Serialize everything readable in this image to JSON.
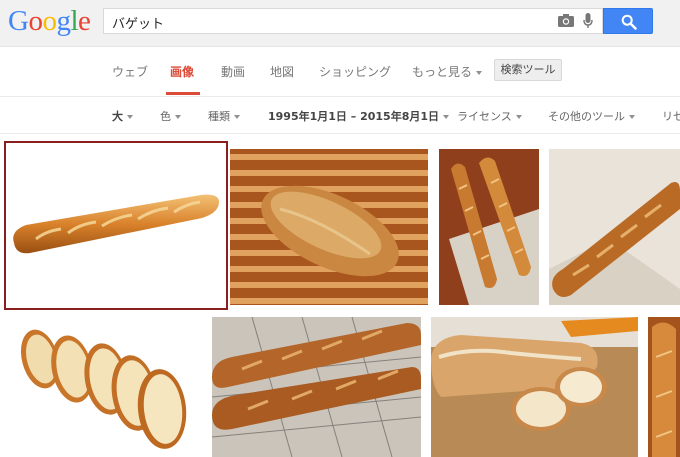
{
  "logo": {
    "letters": [
      "G",
      "o",
      "o",
      "g",
      "l",
      "e"
    ]
  },
  "search": {
    "query": "バゲット"
  },
  "tabs": [
    {
      "label": "ウェブ"
    },
    {
      "label": "画像"
    },
    {
      "label": "動画"
    },
    {
      "label": "地図"
    },
    {
      "label": "ショッピング"
    },
    {
      "label": "もっと見る"
    }
  ],
  "search_tools_label": "検索ツール",
  "filters": [
    {
      "label": "大"
    },
    {
      "label": "色"
    },
    {
      "label": "種類"
    },
    {
      "label": "1995年1月1日 – 2015年8月1日"
    },
    {
      "label": "ライセンス"
    },
    {
      "label": "その他のツール"
    },
    {
      "label": "リセ"
    }
  ],
  "colors": {
    "accent": "#dd4b39",
    "search_button": "#4285f4",
    "selection_border": "#8a1f1f"
  },
  "images": [
    {
      "name": "baguette-white-background"
    },
    {
      "name": "bread-on-rattan-mat"
    },
    {
      "name": "two-baguettes-on-board"
    },
    {
      "name": "baguette-on-cloth"
    },
    {
      "name": "sliced-baguette"
    },
    {
      "name": "baguettes-on-wire-rack"
    },
    {
      "name": "cut-baguette-on-board"
    },
    {
      "name": "baguette-partial"
    }
  ]
}
